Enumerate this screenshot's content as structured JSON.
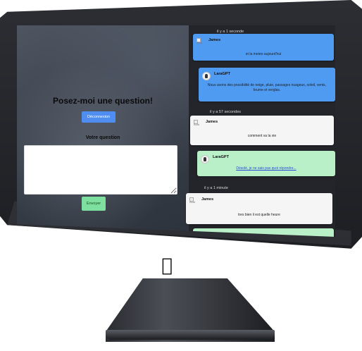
{
  "left_panel": {
    "title": "Posez-moi une question!",
    "logout_button": "Déconnexion",
    "question_label": "Votre question",
    "question_value": "",
    "send_button": "Envoyer"
  },
  "chat": {
    "messages": [
      {
        "time": "il y a 1 seconde",
        "author": "James",
        "avatar_alt": "Avat",
        "text": "et la meteo aujourd'hui"
      },
      {
        "author": "LaraGPT",
        "text": "Nous avons des possibilité de neige, pluie, passages nuageux, soleil, vents, brume et verglas."
      },
      {
        "time": "il y a 57 secondes",
        "author": "James",
        "avatar_alt": "Avat",
        "text": "comment va la vie"
      },
      {
        "author": "LaraGPT",
        "text": "Désolé, je ne sais pas quoi répondre..."
      },
      {
        "time": "il y a 1 minute",
        "author": "James",
        "avatar_alt": "Avat",
        "text": "tres bien il est quelle heure"
      }
    ]
  },
  "colors": {
    "accent_blue": "#4f8ef0",
    "user_bubble": "#4f9bf2",
    "bot_bubble_white": "#f5f5f5",
    "bot_bubble_green": "#b9f0c8",
    "send_button": "#7de09e"
  },
  "icons": {
    "logo": "apple-logo-icon",
    "bot_avatar": "robot-avatar-icon",
    "user_avatar": "broken-image-icon"
  }
}
